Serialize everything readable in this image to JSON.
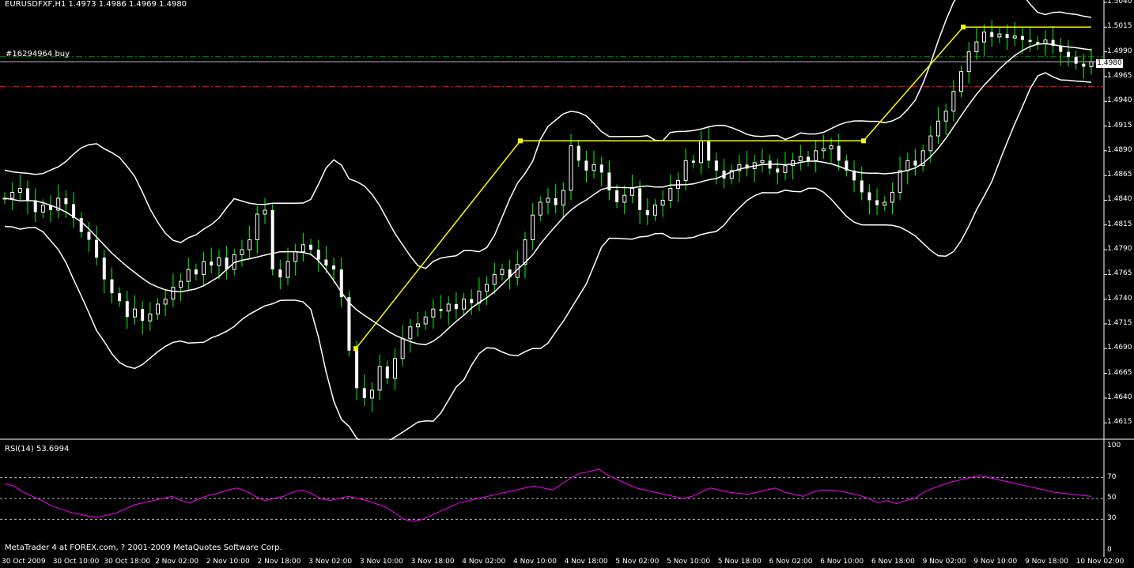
{
  "header": {
    "symbol_info": "EURUSDFXF,H1  1.4973 1.4986 1.4969 1.4980",
    "order_label": "#16294964 buy",
    "rsi_info": "RSI(14) 53.6994",
    "copyright": "MetaTrader 4 at FOREX.com, ? 2001-2009 MetaQuotes Software Corp.",
    "current_price": "1.4980"
  },
  "colors": {
    "background": "#000000",
    "candle_up": "#ffffff",
    "candle_down": "#ffffff",
    "wick": "#00ff00",
    "bollinger": "#ffffff",
    "zigzag": "#ffff00",
    "rsi_line": "#ff00ff",
    "order_line": "#00aa00",
    "stop_line": "#ff0000"
  },
  "chart_data": [
    {
      "type": "candlestick",
      "symbol": "EURUSDFXF",
      "timeframe": "H1",
      "ylim": [
        1.46,
        1.504
      ],
      "y_ticks": [
        "1.5040",
        "1.5015",
        "1.4990",
        "1.4965",
        "1.4940",
        "1.4915",
        "1.4890",
        "1.4865",
        "1.4840",
        "1.4815",
        "1.4790",
        "1.4765",
        "1.4740",
        "1.4715",
        "1.4690",
        "1.4665",
        "1.4640",
        "1.4615"
      ],
      "x_labels": [
        "30 Oct 2009",
        "30 Oct 10:00",
        "30 Oct 18:00",
        "2 Nov 02:00",
        "2 Nov 10:00",
        "2 Nov 18:00",
        "3 Nov 02:00",
        "3 Nov 10:00",
        "3 Nov 18:00",
        "4 Nov 02:00",
        "4 Nov 10:00",
        "4 Nov 18:00",
        "5 Nov 02:00",
        "5 Nov 10:00",
        "5 Nov 18:00",
        "6 Nov 02:00",
        "6 Nov 10:00",
        "6 Nov 18:00",
        "9 Nov 02:00",
        "9 Nov 10:00",
        "9 Nov 18:00",
        "10 Nov 02:00"
      ],
      "order_price": 1.4985,
      "stop_price": 1.4955,
      "close_path": [
        1.4842,
        1.4848,
        1.4852,
        1.484,
        1.4828,
        1.4835,
        1.483,
        1.4842,
        1.4836,
        1.4822,
        1.4808,
        1.48,
        1.4782,
        1.476,
        1.4746,
        1.4738,
        1.4722,
        1.473,
        1.4718,
        1.4725,
        1.4735,
        1.474,
        1.4752,
        1.4758,
        1.477,
        1.4765,
        1.4778,
        1.4774,
        1.4782,
        1.477,
        1.4785,
        1.479,
        1.48,
        1.4826,
        1.483,
        1.477,
        1.4762,
        1.4778,
        1.4788,
        1.4795,
        1.479,
        1.478,
        1.4774,
        1.477,
        1.4742,
        1.4688,
        1.465,
        1.464,
        1.4648,
        1.4672,
        1.466,
        1.468,
        1.47,
        1.4712,
        1.4715,
        1.4722,
        1.473,
        1.4728,
        1.4735,
        1.473,
        1.474,
        1.4736,
        1.4748,
        1.4755,
        1.4765,
        1.477,
        1.4762,
        1.4775,
        1.48,
        1.4825,
        1.4838,
        1.4842,
        1.4835,
        1.485,
        1.4895,
        1.488,
        1.487,
        1.4876,
        1.4868,
        1.485,
        1.4838,
        1.4845,
        1.4852,
        1.483,
        1.4825,
        1.4835,
        1.484,
        1.4852,
        1.486,
        1.488,
        1.4878,
        1.49,
        1.488,
        1.487,
        1.4862,
        1.487,
        1.4876,
        1.4872,
        1.4878,
        1.488,
        1.4872,
        1.4868,
        1.4875,
        1.488,
        1.4884,
        1.488,
        1.489,
        1.4892,
        1.4895,
        1.488,
        1.487,
        1.486,
        1.4848,
        1.484,
        1.4835,
        1.4838,
        1.4848,
        1.487,
        1.488,
        1.4875,
        1.489,
        1.4905,
        1.492,
        1.493,
        1.495,
        1.497,
        1.499,
        1.5,
        1.501,
        1.5005,
        1.5008,
        1.5004,
        1.5006,
        1.5002,
        1.5,
        1.4998,
        1.5002,
        1.4996,
        1.499,
        1.4985,
        1.4978,
        1.4975,
        1.498
      ]
    },
    {
      "type": "line",
      "name": "RSI(14)",
      "ylim": [
        0,
        100
      ],
      "y_ticks": [
        "100",
        "70",
        "50",
        "30",
        "0"
      ],
      "levels": [
        30,
        50,
        70
      ],
      "values": [
        64,
        62,
        56,
        52,
        48,
        43,
        40,
        37,
        35,
        33,
        32,
        34,
        36,
        40,
        44,
        46,
        48,
        50,
        52,
        48,
        46,
        50,
        53,
        55,
        58,
        60,
        57,
        52,
        48,
        50,
        52,
        56,
        58,
        55,
        50,
        48,
        50,
        52,
        50,
        48,
        45,
        42,
        36,
        30,
        28,
        30,
        34,
        38,
        42,
        46,
        48,
        50,
        52,
        54,
        56,
        58,
        60,
        62,
        60,
        58,
        64,
        70,
        74,
        76,
        78,
        72,
        68,
        64,
        60,
        58,
        56,
        54,
        52,
        50,
        52,
        56,
        60,
        58,
        56,
        55,
        54,
        56,
        58,
        60,
        56,
        54,
        52,
        56,
        58,
        58,
        57,
        55,
        53,
        50,
        46,
        48,
        45,
        48,
        50,
        56,
        60,
        63,
        66,
        68,
        70,
        72,
        70,
        68,
        66,
        64,
        62,
        60,
        58,
        56,
        55,
        54,
        53,
        52
      ]
    }
  ]
}
